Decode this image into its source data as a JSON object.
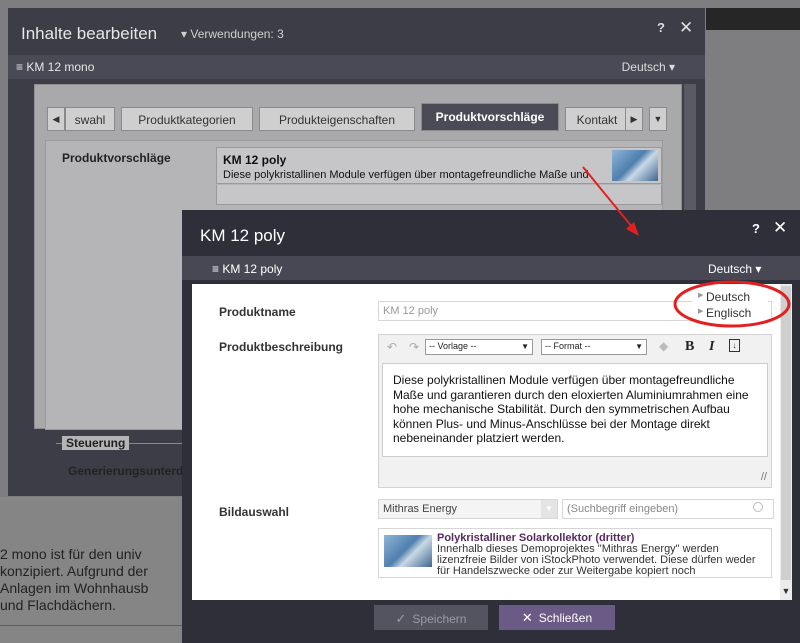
{
  "background": {
    "lines": [
      "2 mono ist für den univ",
      "konzipiert. Aufgrund der",
      "Anlagen im Wohnhausb",
      "und Flachdächern."
    ]
  },
  "outer_dialog": {
    "title": "Inhalte bearbeiten",
    "usage_label": "▾ Verwendungen: 3",
    "help": "?",
    "close": "✕",
    "record_name": "≡ KM 12 mono",
    "language": "Deutsch ▾",
    "tab_prev": "◀",
    "tabs": [
      "swahl",
      "Produktkategorien",
      "Produkteigenschaften",
      "Produktvorschläge",
      "Kontakt"
    ],
    "tab_next": "▶",
    "tab_menu": "▼",
    "field_label": "Produktvorschläge",
    "suggestion": {
      "title": "KM 12 poly",
      "desc": "Diese polykristallinen Module verfügen über montagefreundliche Maße und"
    },
    "section": "Steuerung",
    "section_field": "Generierungsunterdrück"
  },
  "inner_dialog": {
    "title": "KM 12 poly",
    "help": "?",
    "close": "✕",
    "record_name": "≡ KM 12 poly",
    "language": "Deutsch ▾",
    "language_options": [
      "Deutsch",
      "Englisch"
    ],
    "fields": {
      "name_label": "Produktname",
      "name_value": "KM 12 poly",
      "desc_label": "Produktbeschreibung",
      "template_select": "-- Vorlage --",
      "format_select": "-- Format --",
      "bold": "B",
      "italic": "I",
      "desc_text": "Diese polykristallinen Module verfügen über montagefreundliche Maße und garantieren durch den eloxierten Aluminiumrahmen eine hohe mechanische Stabilität. Durch den symmetrischen Aufbau können Plus- und Minus-Anschlüsse bei der Montage direkt nebeneinander platziert werden.",
      "image_label": "Bildauswahl",
      "image_source": "Mithras Energy",
      "image_search_placeholder": "(Suchbegriff eingeben)",
      "image_result_title": "Polykristalliner Solarkollektor (dritter)",
      "image_result_desc": "Innerhalb dieses Demoprojektes \"Mithras Energy\" werden lizenzfreie Bilder von iStockPhoto verwendet. Diese dürfen weder für Handelszwecke oder zur Weitergabe kopiert noch"
    },
    "buttons": {
      "save": "Speichern",
      "close": "Schließen"
    }
  },
  "colors": {
    "dialog_dark": "#2f2f3a",
    "accent_button": "#6a5a86",
    "annotation_red": "#e32020"
  }
}
